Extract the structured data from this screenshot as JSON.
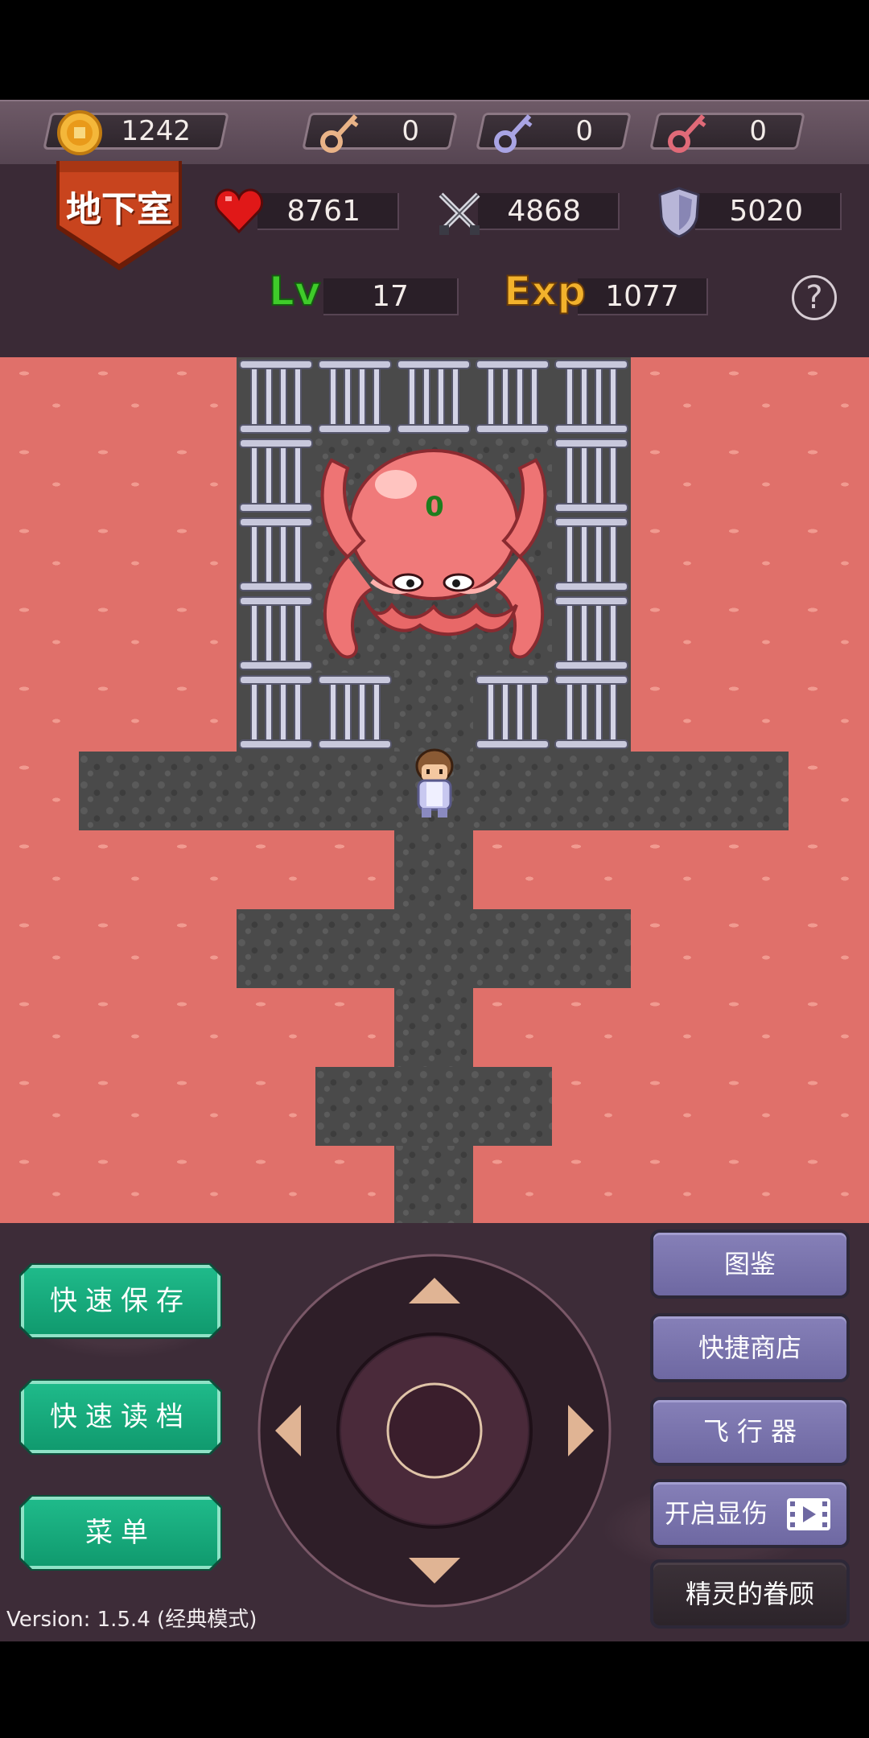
{
  "resources": {
    "gold": "1242",
    "yellow_keys": "0",
    "blue_keys": "0",
    "red_keys": "0"
  },
  "floor": {
    "name": "地下室"
  },
  "stats": {
    "hp": "8761",
    "attack": "4868",
    "defense": "5020",
    "level_label": "Lv",
    "level": "17",
    "exp_label": "Exp",
    "exp": "1077"
  },
  "help": {
    "icon": "?"
  },
  "board": {
    "boss_damage": "0",
    "boss": "red-octopus",
    "hero": "brave-hero"
  },
  "buttons": {
    "quick_save": "快速保存",
    "quick_load": "快速读档",
    "menu": "菜单",
    "monster_book": "图鉴",
    "quick_shop": "快捷商店",
    "fly": "飞 行 器",
    "show_damage": "开启显伤",
    "fairy_blessing": "精灵的眷顾"
  },
  "footer": {
    "version": "Version: 1.5.4 (经典模式)"
  },
  "colors": {
    "lava": "#e0706a",
    "floor": "#4a4a4a",
    "green_button": "#1fba8a",
    "purple_button": "#7a74ae"
  }
}
